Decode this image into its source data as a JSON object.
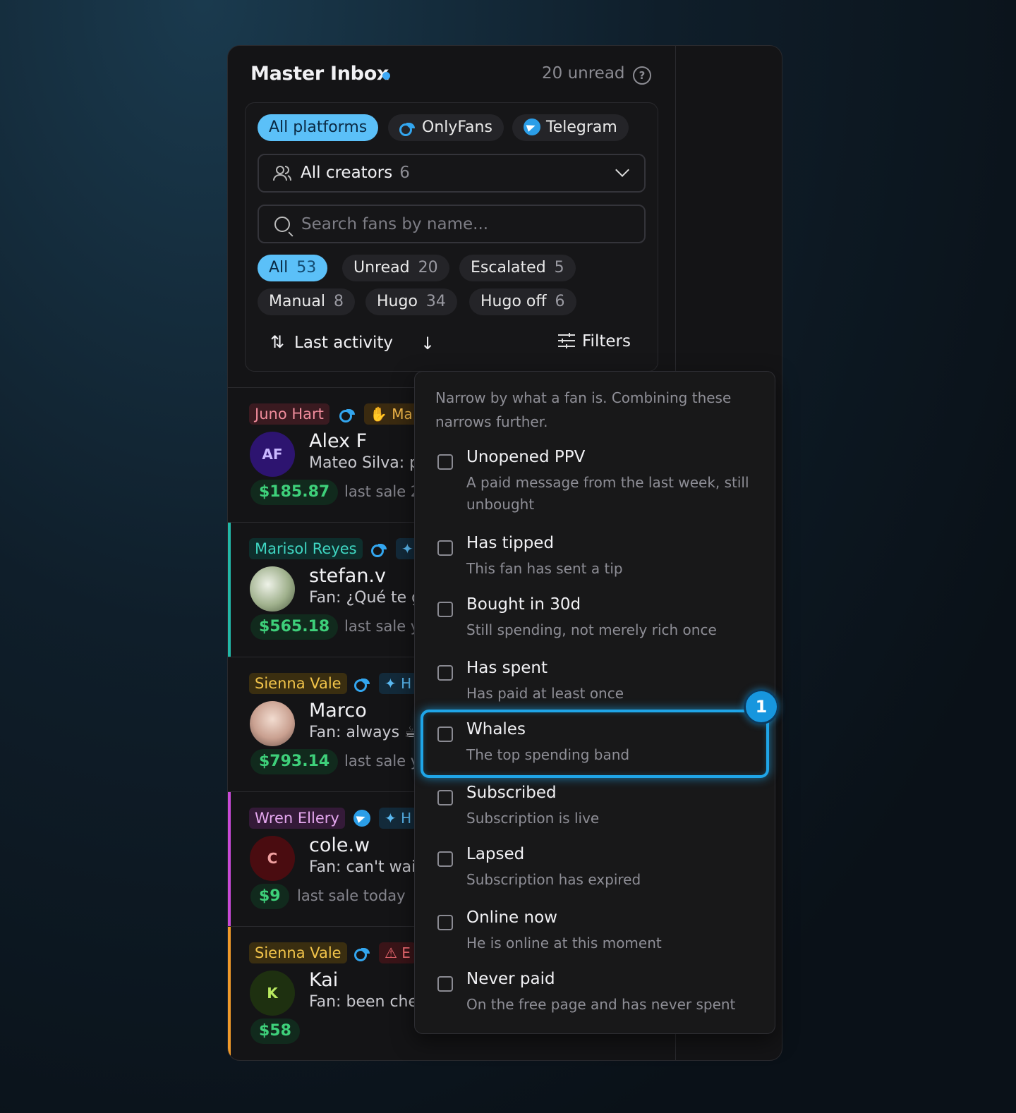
{
  "header": {
    "title": "Master Inbox",
    "unread": "20 unread"
  },
  "platforms": [
    {
      "label": "All platforms",
      "active": true
    },
    {
      "label": "OnlyFans",
      "active": false
    },
    {
      "label": "Telegram",
      "active": false
    }
  ],
  "creators_select": {
    "label": "All creators",
    "count": "6"
  },
  "search": {
    "placeholder": "Search fans by name..."
  },
  "segments": [
    {
      "label": "All",
      "count": "53",
      "active": true
    },
    {
      "label": "Unread",
      "count": "20"
    },
    {
      "label": "Escalated",
      "count": "5"
    },
    {
      "label": "Manual",
      "count": "8"
    },
    {
      "label": "Hugo",
      "count": "34"
    },
    {
      "label": "Hugo off",
      "count": "6"
    }
  ],
  "sort": {
    "label": "Last activity",
    "filters_label": "Filters"
  },
  "rows": [
    {
      "creator": "Juno Hart",
      "extra_tag": "Ma",
      "avatar": "AF",
      "fan": "Alex F",
      "msg_prefix": "Mateo Silva:",
      "msg": " p",
      "price": "$185.87",
      "last_sale": "last sale 2"
    },
    {
      "creator": "Marisol Reyes",
      "avatar": "",
      "fan": "stefan.v",
      "msg_prefix": "Fan:",
      "msg": " ¿Qué te g",
      "price": "$565.18",
      "last_sale": "last sale y"
    },
    {
      "creator": "Sienna Vale",
      "extra_tag": "H",
      "avatar": "",
      "fan": "Marco",
      "msg_prefix": "Fan:",
      "msg": " always ☕",
      "price": "$793.14",
      "last_sale": "last sale y"
    },
    {
      "creator": "Wren Ellery",
      "extra_tag": "H",
      "avatar": "C",
      "fan": "cole.w",
      "msg_prefix": "Fan:",
      "msg": " can't wai",
      "price": "$9",
      "last_sale": "last sale today"
    },
    {
      "creator": "Sienna Vale",
      "extra_tag": "E",
      "avatar": "K",
      "fan": "Kai",
      "msg_prefix": "Fan:",
      "msg": " been che",
      "price": "$58",
      "last_sale": ""
    }
  ],
  "filters_dropdown": {
    "intro": "Narrow by what a fan is. Combining these narrows further.",
    "options": [
      {
        "title": "Unopened PPV",
        "desc": "A paid message from the last week, still unbought"
      },
      {
        "title": "Has tipped",
        "desc": "This fan has sent a tip"
      },
      {
        "title": "Bought in 30d",
        "desc": "Still spending, not merely rich once"
      },
      {
        "title": "Has spent",
        "desc": "Has paid at least once"
      },
      {
        "title": "Whales",
        "desc": "The top spending band"
      },
      {
        "title": "Subscribed",
        "desc": "Subscription is live"
      },
      {
        "title": "Lapsed",
        "desc": "Subscription has expired"
      },
      {
        "title": "Online now",
        "desc": "He is online at this moment"
      },
      {
        "title": "Never paid",
        "desc": "On the free page and has never spent"
      }
    ]
  },
  "highlight_badge": "1"
}
